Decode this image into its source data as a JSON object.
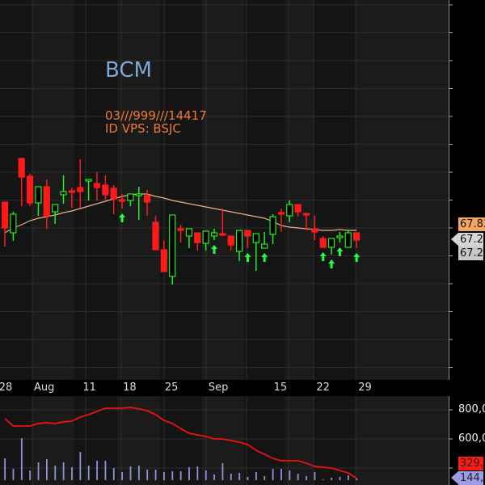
{
  "chart_data": {
    "type": "candlestick",
    "symbol": "BCM",
    "annotations": [
      "03///999///14417",
      "ID VPS: BSJC"
    ],
    "x_ticks": [
      {
        "label": "28",
        "index": 0.1
      },
      {
        "label": "Aug",
        "index": 4.7
      },
      {
        "label": "11",
        "index": 10.1
      },
      {
        "label": "18",
        "index": 14.9
      },
      {
        "label": "25",
        "index": 19.9
      },
      {
        "label": "Sep",
        "index": 25.5
      },
      {
        "label": "15",
        "index": 32.9
      },
      {
        "label": "22",
        "index": 38.0
      },
      {
        "label": "29",
        "index": 43.0
      }
    ],
    "price_labels": [
      {
        "text": "67.83",
        "value": 67.83,
        "color": "#f4a660"
      },
      {
        "text": "67.2",
        "value": 67.2,
        "color": "#d6d6d6",
        "pointer": true
      },
      {
        "text": "67.2",
        "value": 66.7,
        "color": "#c8c8c8"
      }
    ],
    "ohlc": [
      [
        68.64,
        68.64,
        66.99,
        67.68
      ],
      [
        67.5,
        68.28,
        67.2,
        68.19
      ],
      [
        70.26,
        70.26,
        68.49,
        69.57
      ],
      [
        69.6,
        69.69,
        68.49,
        68.61
      ],
      [
        68.61,
        69.21,
        68.13,
        69.21
      ],
      [
        69.21,
        69.48,
        67.65,
        68.13
      ],
      [
        68.28,
        68.55,
        67.83,
        68.55
      ],
      [
        68.91,
        69.63,
        68.58,
        69.03
      ],
      [
        69.06,
        69.18,
        68.43,
        69.0
      ],
      [
        69.18,
        70.23,
        68.43,
        69.03
      ],
      [
        69.42,
        69.48,
        68.7,
        69.48
      ],
      [
        69.33,
        69.75,
        68.7,
        69.18
      ],
      [
        69.27,
        69.63,
        68.73,
        68.91
      ],
      [
        69.15,
        69.27,
        68.19,
        68.76
      ],
      [
        68.73,
        68.94,
        68.4,
        68.67
      ],
      [
        68.7,
        68.94,
        68.49,
        68.94
      ],
      [
        68.88,
        69.21,
        67.98,
        68.94
      ],
      [
        68.88,
        69.09,
        68.13,
        68.64
      ],
      [
        67.89,
        68.13,
        66.87,
        66.87
      ],
      [
        66.87,
        67.23,
        66.06,
        66.06
      ],
      [
        65.88,
        68.16,
        65.58,
        68.16
      ],
      [
        67.65,
        67.8,
        67.14,
        67.59
      ],
      [
        67.38,
        67.65,
        66.93,
        67.65
      ],
      [
        67.5,
        67.5,
        66.84,
        67.14
      ],
      [
        67.11,
        67.56,
        66.84,
        67.56
      ],
      [
        67.38,
        67.65,
        67.23,
        67.5
      ],
      [
        67.47,
        68.4,
        67.38,
        67.41
      ],
      [
        67.38,
        67.38,
        66.84,
        67.05
      ],
      [
        66.81,
        67.59,
        66.45,
        67.59
      ],
      [
        67.59,
        67.59,
        66.93,
        67.38
      ],
      [
        67.14,
        67.47,
        66.09,
        67.47
      ],
      [
        66.93,
        67.53,
        66.93,
        67.08
      ],
      [
        67.44,
        68.19,
        67.08,
        68.1
      ],
      [
        68.25,
        68.4,
        67.53,
        68.19
      ],
      [
        68.13,
        68.7,
        67.89,
        68.55
      ],
      [
        68.55,
        68.55,
        68.1,
        68.28
      ],
      [
        68.22,
        68.22,
        67.59,
        68.16
      ],
      [
        67.65,
        68.13,
        67.23,
        67.53
      ],
      [
        67.29,
        67.38,
        66.96,
        66.96
      ],
      [
        66.96,
        67.29,
        66.69,
        67.29
      ],
      [
        67.32,
        67.53,
        67.14,
        67.38
      ],
      [
        66.96,
        67.59,
        66.96,
        67.5
      ],
      [
        67.5,
        67.5,
        66.93,
        67.23
      ]
    ],
    "buy_signal_indices": [
      14,
      25,
      29,
      31,
      38,
      39,
      40,
      42
    ],
    "price_ma": [
      67.5,
      67.68,
      67.8,
      67.95,
      68.04,
      68.1,
      68.16,
      68.25,
      68.31,
      68.4,
      68.49,
      68.58,
      68.67,
      68.76,
      68.85,
      68.91,
      68.94,
      68.94,
      68.85,
      68.79,
      68.7,
      68.64,
      68.58,
      68.52,
      68.46,
      68.4,
      68.34,
      68.28,
      68.22,
      68.16,
      68.1,
      68.04,
      67.92,
      67.77,
      67.71,
      67.68,
      67.65,
      67.62,
      67.59,
      67.59,
      67.62,
      67.59,
      67.59
    ],
    "volume_k": [
      444,
      288,
      744,
      264,
      384,
      432,
      336,
      384,
      312,
      540,
      336,
      408,
      408,
      300,
      240,
      324,
      336,
      276,
      276,
      240,
      252,
      252,
      312,
      324,
      264,
      204,
      372,
      216,
      228,
      168,
      240,
      180,
      288,
      288,
      264,
      216,
      180,
      240,
      132,
      156,
      168,
      192,
      144
    ],
    "volume_ma_k": [
      739,
      689,
      689,
      689,
      706,
      711,
      706,
      717,
      722,
      750,
      767,
      789,
      811,
      811,
      811,
      817,
      806,
      794,
      767,
      728,
      706,
      672,
      639,
      628,
      617,
      600,
      600,
      589,
      578,
      561,
      522,
      494,
      467,
      450,
      450,
      450,
      433,
      411,
      406,
      400,
      383,
      367,
      329
    ],
    "volume_axis": [
      {
        "text": "800,0",
        "value": 800
      },
      {
        "text": "600,0",
        "value": 600
      }
    ],
    "volume_labels": [
      {
        "text": "329,",
        "color": "#ff1a1a"
      },
      {
        "text": "144,",
        "color": "#9c9ce6",
        "pointer": true
      }
    ],
    "colors": {
      "up": "#22ee22",
      "down": "#ff1a1a",
      "ma": "#e6b08c",
      "volume": "#9090e0",
      "vol_ma": "#ee1111",
      "arrow": "#22ff44",
      "title": "#7fa8d8",
      "annotation": "#f07a30"
    }
  }
}
